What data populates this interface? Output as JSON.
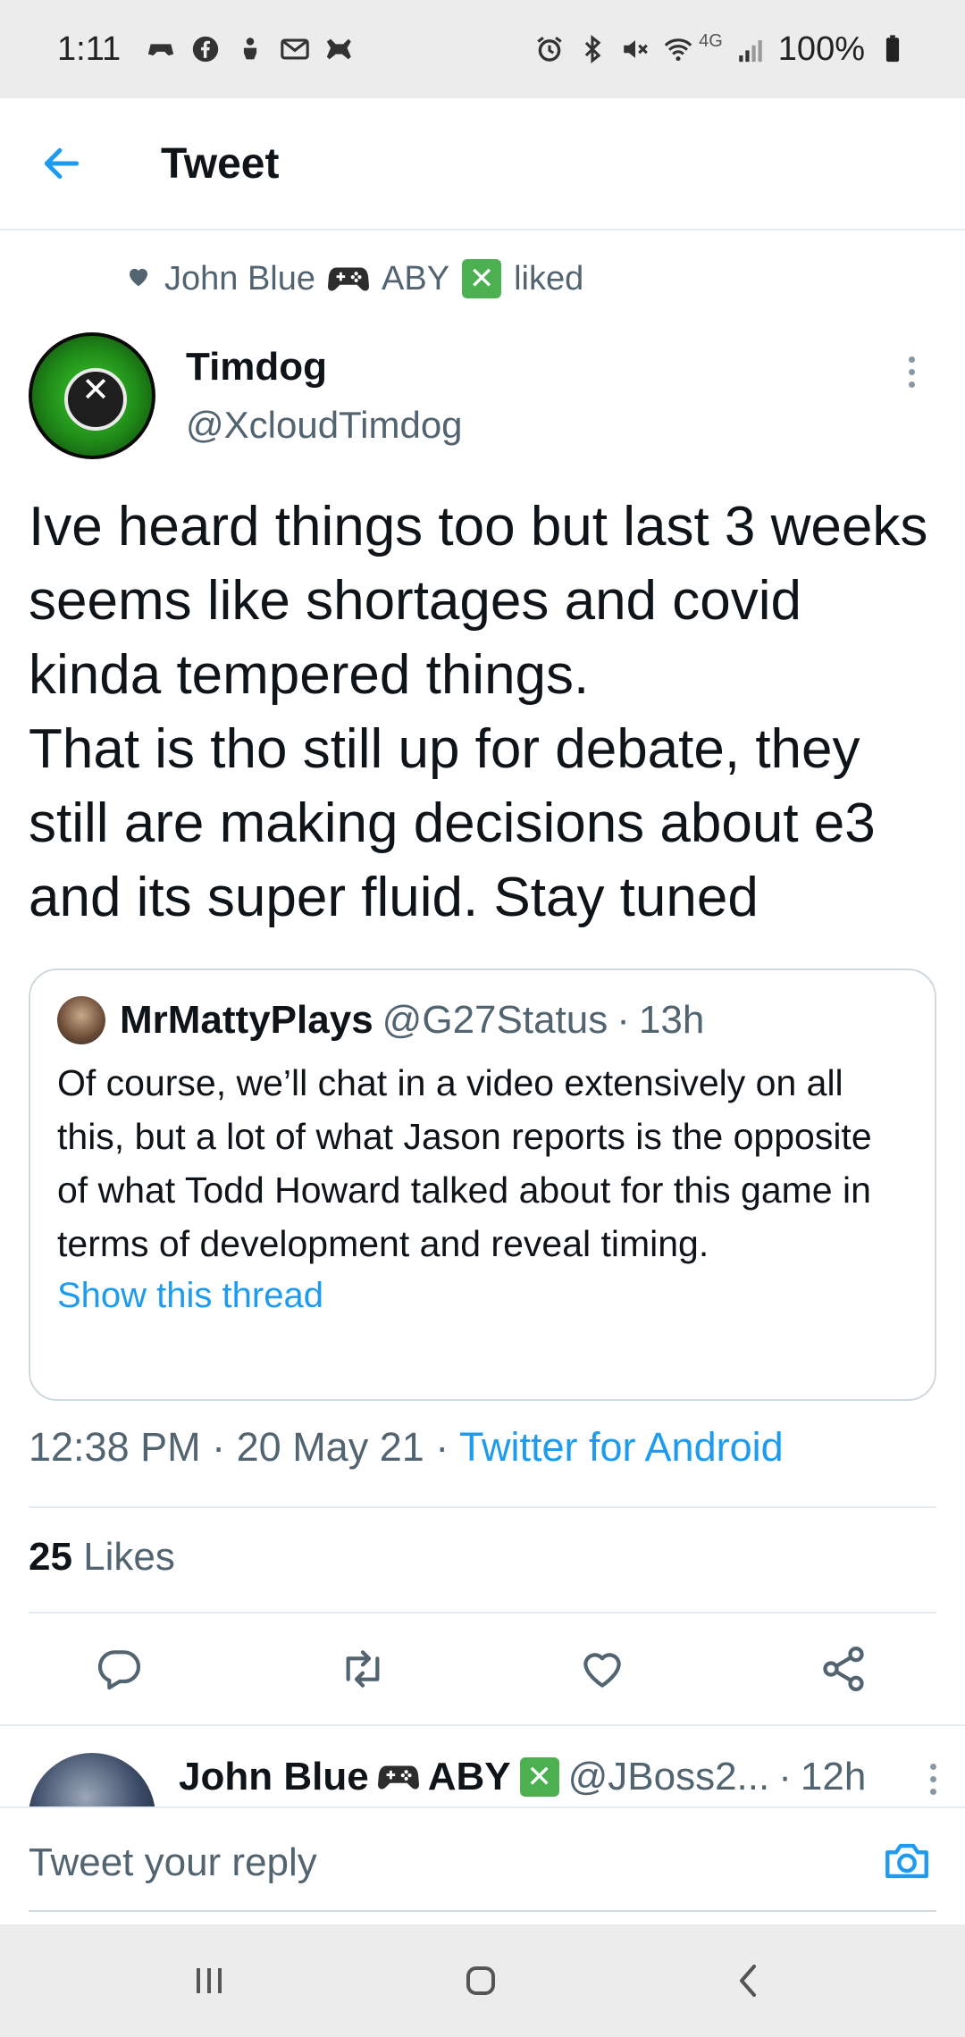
{
  "status_bar": {
    "time": "1:11",
    "left_icons": [
      "game-controller-icon",
      "facebook-icon",
      "anchor-icon",
      "mail-icon",
      "gamepad-icon"
    ],
    "right_icons": [
      "alarm-icon",
      "bluetooth-icon",
      "mute-icon",
      "wifi-icon",
      "signal-icon"
    ],
    "network": "4G",
    "battery": "100%"
  },
  "header": {
    "title": "Tweet"
  },
  "social_context": {
    "name": "John Blue",
    "tag": "ABY",
    "action": "liked"
  },
  "tweet": {
    "author_name": "Timdog",
    "author_handle": "@XcloudTimdog",
    "text": "Ive heard things too but last 3 weeks seems like shortages and covid kinda tempered things.\nThat is tho still up for debate, they still are making decisions about e3 and its super fluid.  Stay tuned",
    "time": "12:38 PM",
    "date": "20 May 21",
    "source": "Twitter for Android",
    "likes_count": "25",
    "likes_label": "Likes"
  },
  "quote_tweet": {
    "name": "MrMattyPlays",
    "handle": "@G27Status",
    "age": "13h",
    "text": "Of course, we’ll chat in a video extensively on all this, but a lot of what Jason reports is the opposite of what Todd Howard talked about for this game in terms of development and reveal timing.",
    "show_thread": "Show this thread"
  },
  "reply_preview": {
    "name": "John Blue",
    "tag": "ABY",
    "handle": "@JBoss2...",
    "age": "12h"
  },
  "composer": {
    "placeholder": "Tweet your reply"
  },
  "colors": {
    "accent": "#1d9bf0",
    "secondary_text": "#536471",
    "status_bar_bg": "#ececec",
    "xbox_green": "#4caf50"
  }
}
